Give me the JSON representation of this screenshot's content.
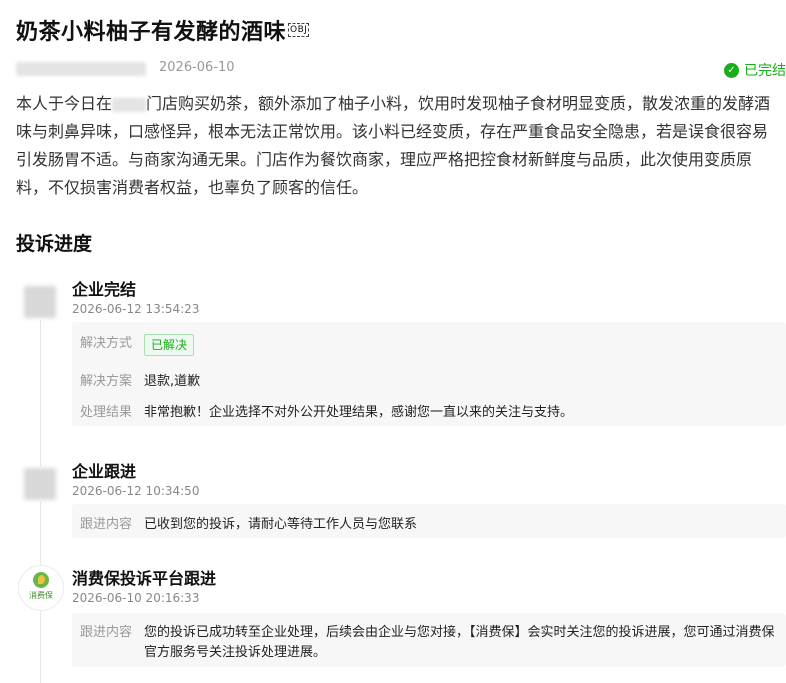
{
  "complaint": {
    "title": "奶茶小料柚子有发酵的酒味",
    "obj_marker": "OBJ",
    "date": "2026-06-10",
    "status": "已完结",
    "body_part1": "本人于今日在",
    "body_part2": "门店购买奶茶，额外添加了柚子小料，饮用时发现柚子食材明显变质，散发浓重的发酵酒味与刺鼻异味，口感怪异，根本无法正常饮用。该小料已经变质，存在严重食品安全隐患，若是误食很容易引发肠胃不适。与商家沟通无果。门店作为餐饮商家，理应严格把控食材新鲜度与品质，此次使用变质原料，不仅损害消费者权益，也辜负了顾客的信任。"
  },
  "progress": {
    "section_title": "投诉进度",
    "items": [
      {
        "title": "企业完结",
        "time": "2026-06-12 13:54:23",
        "rows": [
          {
            "key": "解决方式",
            "value": "已解决"
          },
          {
            "key": "解决方案",
            "value": "退款,道歉"
          },
          {
            "key": "处理结果",
            "value": "非常抱歉！企业选择不对外公开处理结果，感谢您一直以来的关注与支持。"
          }
        ]
      },
      {
        "title": "企业跟进",
        "time": "2026-06-12 10:34:50",
        "rows": [
          {
            "key": "跟进内容",
            "value": "已收到您的投诉，请耐心等待工作人员与您联系"
          }
        ]
      },
      {
        "title": "消费保投诉平台跟进",
        "time": "2026-06-10 20:16:33",
        "logo_text": "消费保",
        "rows": [
          {
            "key": "跟进内容",
            "value": "您的投诉已成功转至企业处理，后续会由企业与您对接，【消费保】会实时关注您的投诉进展，您可通过消费保官方服务号关注投诉处理进展。"
          }
        ]
      }
    ]
  },
  "colors": {
    "accent_green": "#1aad19",
    "muted": "#999999",
    "panel_bg": "#f7f7f7"
  }
}
